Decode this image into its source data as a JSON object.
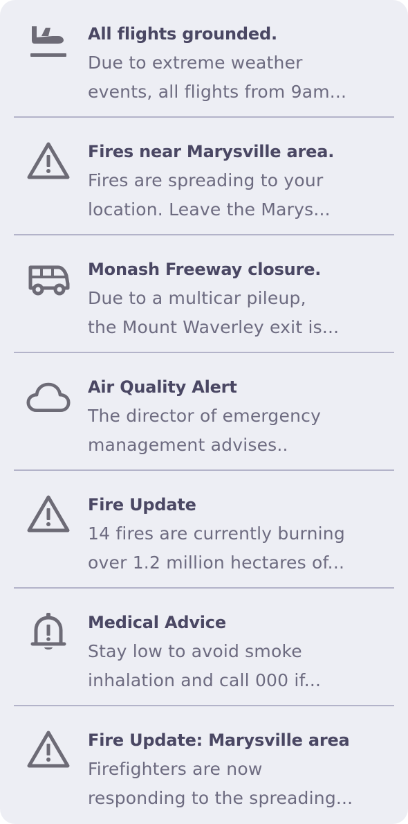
{
  "colors": {
    "panel_background": "#edeef4",
    "divider": "#b3b3c9",
    "title_text": "#4a4763",
    "body_text": "#6d6b80",
    "icon": "#6d6b76"
  },
  "alerts": [
    {
      "icon": "flight-landing-icon",
      "title": "All flights grounded.",
      "line1": "Due to extreme weather",
      "line2": "events, all flights from 9am..."
    },
    {
      "icon": "warning-triangle-icon",
      "title": "Fires near Marysville area.",
      "line1": "Fires are spreading to your",
      "line2": "location. Leave the Marys..."
    },
    {
      "icon": "bus-icon",
      "title": "Monash Freeway closure.",
      "line1": "Due to a multicar pileup,",
      "line2": "the Mount Waverley exit is..."
    },
    {
      "icon": "cloud-icon",
      "title": "Air Quality Alert",
      "line1": "The director of emergency",
      "line2": "management advises.."
    },
    {
      "icon": "warning-triangle-icon",
      "title": "Fire Update",
      "line1": "14 fires are currently burning",
      "line2": "over 1.2 million hectares of..."
    },
    {
      "icon": "bell-alert-icon",
      "title": "Medical Advice",
      "line1": "Stay low to avoid smoke",
      "line2": "inhalation and call 000 if..."
    },
    {
      "icon": "warning-triangle-icon",
      "title": "Fire Update: Marysville area",
      "line1": "Firefighters are now",
      "line2": "responding to the spreading..."
    }
  ]
}
